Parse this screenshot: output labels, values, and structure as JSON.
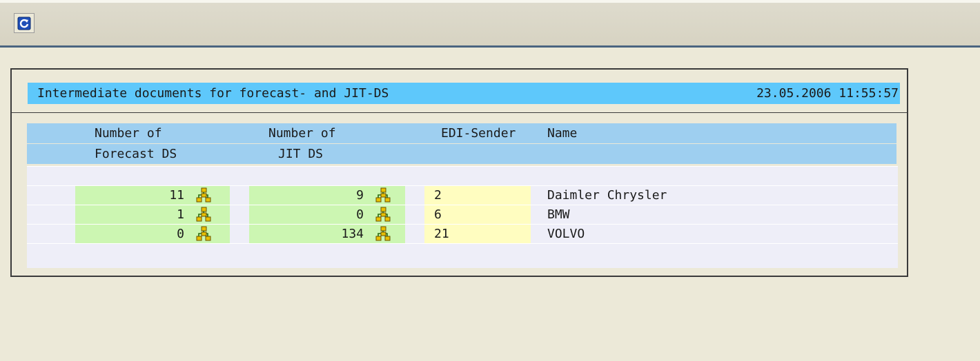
{
  "toolbar": {
    "refresh_icon": "refresh-icon"
  },
  "panel": {
    "title": "Intermediate documents for forecast- and JIT-DS",
    "timestamp": "23.05.2006 11:55:57",
    "headers": {
      "row1": {
        "forecast": "Number of",
        "jit": "Number of",
        "sender": "EDI-Sender",
        "name": "Name"
      },
      "row2": {
        "forecast": "Forecast DS",
        "jit": "JIT DS"
      }
    },
    "rows": [
      {
        "forecast": "11",
        "jit": "9",
        "sender": "2",
        "name": "Daimler Chrysler"
      },
      {
        "forecast": "1",
        "jit": "0",
        "sender": "6",
        "name": "BMW"
      },
      {
        "forecast": "0",
        "jit": "134",
        "sender": "21",
        "name": "VOLVO"
      }
    ],
    "colors": {
      "title_bg": "#5ec8fb",
      "header_bg": "#9ecff0",
      "number_bg": "#ccf6b2",
      "sender_bg": "#fffdc0"
    }
  }
}
